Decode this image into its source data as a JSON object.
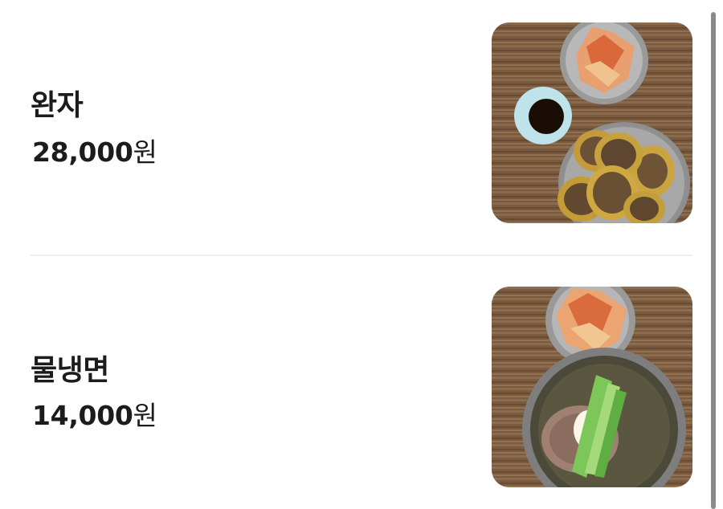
{
  "menu": {
    "items": [
      {
        "name": "완자",
        "price_amount": "28,000",
        "price_unit": "원",
        "photo_icon": "wanja-dish-photo"
      },
      {
        "name": "물냉면",
        "price_amount": "14,000",
        "price_unit": "원",
        "photo_icon": "mul-naengmyeon-dish-photo"
      }
    ]
  },
  "colors": {
    "text": "#1c1c1c",
    "divider": "#efefef",
    "scrollbar": "#8a8a8a",
    "background": "#ffffff"
  }
}
